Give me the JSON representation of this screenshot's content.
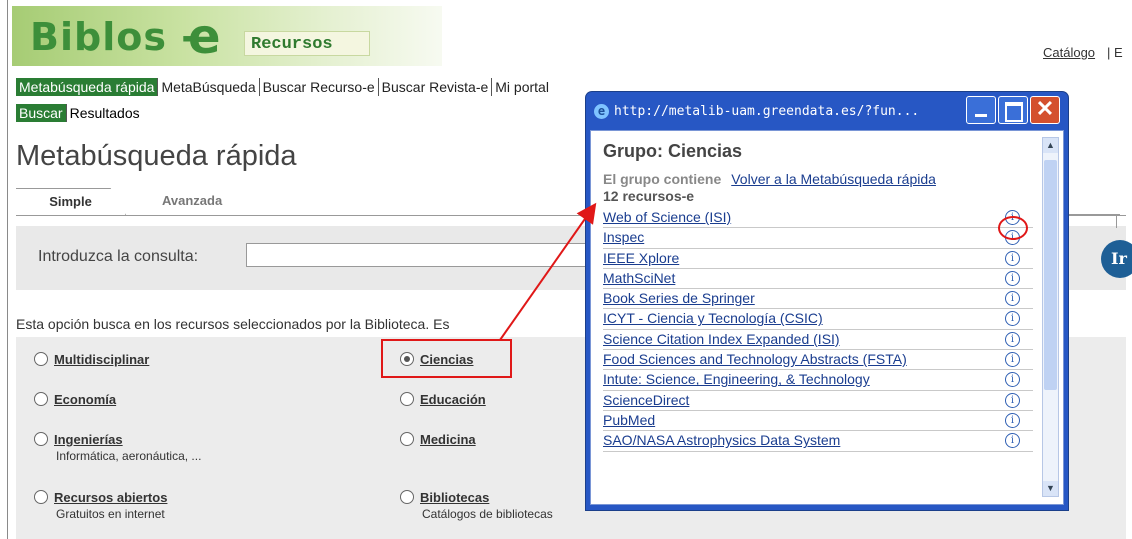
{
  "header": {
    "logo_text": "Biblos",
    "logo_dash": "-",
    "logo_e": "e",
    "logo_sub": "Recursos",
    "top_link": "Catálogo",
    "top_link_sep": "| E"
  },
  "nav": {
    "items": [
      "Metabúsqueda rápida",
      "MetaBúsqueda",
      "Buscar Recurso-e",
      "Buscar Revista-e",
      "Mi portal"
    ]
  },
  "subnav": {
    "items": [
      "Buscar",
      "Resultados"
    ]
  },
  "page_title": "Metabúsqueda rápida",
  "tabs": [
    "Simple",
    "Avanzada"
  ],
  "query": {
    "label": "Introduzca la consulta:",
    "value": "",
    "go_label": "Ir"
  },
  "description": "Esta opción busca en los recursos seleccionados por la Biblioteca. Es",
  "groups": [
    {
      "label": "Multidisciplinar",
      "sub": ""
    },
    {
      "label": "Ciencias",
      "sub": "",
      "selected": true
    },
    {
      "label": "Economía",
      "sub": ""
    },
    {
      "label": "Educación",
      "sub": ""
    },
    {
      "label": "Ingenierías",
      "sub": "Informática, aeronáutica, ..."
    },
    {
      "label": "Medicina",
      "sub": ""
    },
    {
      "label": "Recursos abiertos",
      "sub": "Gratuitos en internet"
    },
    {
      "label": "Bibliotecas",
      "sub": "Catálogos de bibliotecas"
    }
  ],
  "popup": {
    "title": "http://metalib-uam.greendata.es/?fun...",
    "heading": "Grupo: Ciencias",
    "contains_label": "El grupo contiene",
    "back_link": "Volver a la Metabúsqueda rápida",
    "count": "12 recursos-e",
    "resources": [
      "Web of Science (ISI)",
      "Inspec",
      "IEEE Xplore",
      "MathSciNet",
      "Book Series de Springer",
      "ICYT - Ciencia y Tecnología (CSIC)",
      "Science Citation Index Expanded (ISI)",
      "Food Sciences and Technology Abstracts (FSTA)",
      "Intute: Science, Engineering, & Technology",
      "ScienceDirect",
      "PubMed",
      "SAO/NASA Astrophysics Data System"
    ],
    "info_glyph": "i",
    "close_glyph": "✕"
  },
  "colors": {
    "accent_green": "#2a7d34",
    "popup_blue": "#2757c4",
    "annotation_red": "#e01818",
    "link_blue": "#1a3d8f"
  }
}
